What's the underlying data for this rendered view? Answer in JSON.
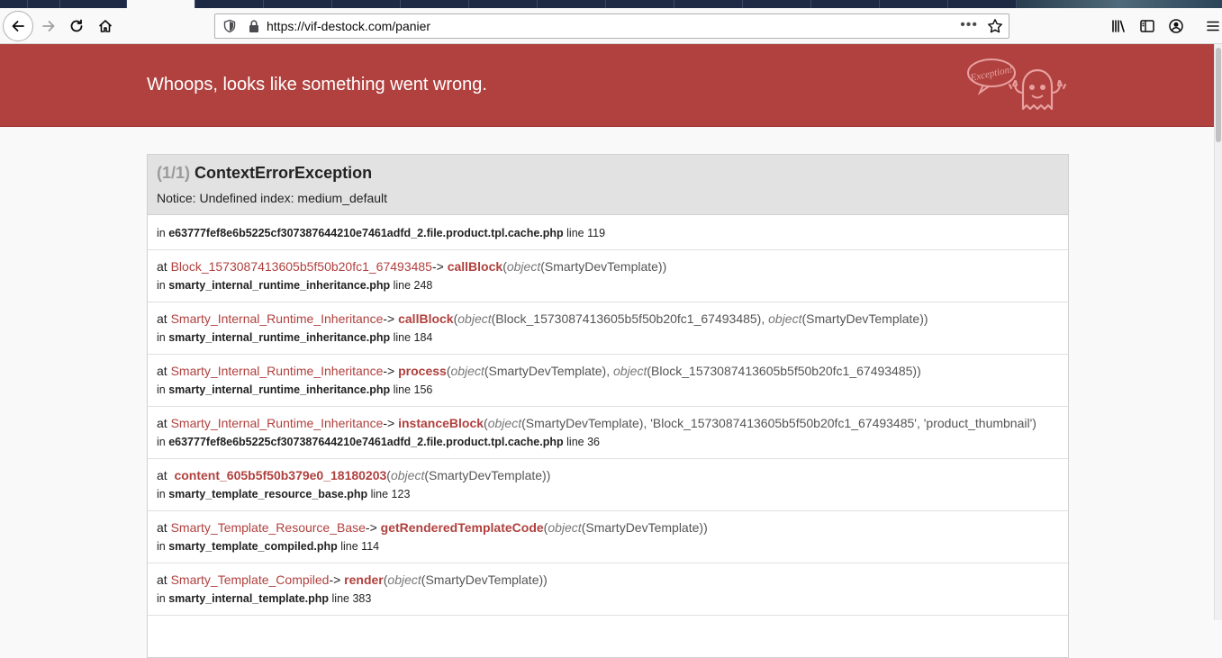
{
  "browser": {
    "url": "https://vif-destock.com/panier",
    "urlbar_menu_label": "•••"
  },
  "exception": {
    "header_title": "Whoops, looks like something went wrong.",
    "mascot_bubble_text": "Exception!",
    "count_label": "(1/1)",
    "class_name": "ContextErrorException",
    "message": "Notice: Undefined index: medium_default",
    "trace": [
      {
        "prefix": "in",
        "file": "e63777fef8e6b5225cf307387644210e7461adfd_2.file.product.tpl.cache.php",
        "line": "line 119"
      },
      {
        "prefix": "at",
        "class": "Block_1573087413605b5f50b20fc1_67493485",
        "arrow": "->",
        "method": "callBlock",
        "open": "(",
        "args": "object(SmartyDevTemplate)",
        "close": ")",
        "in_file": "smarty_internal_runtime_inheritance.php",
        "in_line": "line 248"
      },
      {
        "prefix": "at",
        "class": "Smarty_Internal_Runtime_Inheritance",
        "arrow": "->",
        "method": "callBlock",
        "open": "(",
        "args": "object(Block_1573087413605b5f50b20fc1_67493485), object(SmartyDevTemplate)",
        "close": ")",
        "in_file": "smarty_internal_runtime_inheritance.php",
        "in_line": "line 184"
      },
      {
        "prefix": "at",
        "class": "Smarty_Internal_Runtime_Inheritance",
        "arrow": "->",
        "method": "process",
        "open": "(",
        "args": "object(SmartyDevTemplate), object(Block_1573087413605b5f50b20fc1_67493485)",
        "close": ")",
        "in_file": "smarty_internal_runtime_inheritance.php",
        "in_line": "line 156"
      },
      {
        "prefix": "at",
        "class": "Smarty_Internal_Runtime_Inheritance",
        "arrow": "->",
        "method": "instanceBlock",
        "open": "(",
        "args": "object(SmartyDevTemplate), 'Block_1573087413605b5f50b20fc1_67493485', 'product_thumbnail'",
        "close": ")",
        "in_file": "e63777fef8e6b5225cf307387644210e7461adfd_2.file.product.tpl.cache.php",
        "in_line": "line 36"
      },
      {
        "prefix": "at",
        "class": "",
        "arrow": "",
        "method": "content_605b5f50b379e0_18180203",
        "open": "(",
        "args": "object(SmartyDevTemplate)",
        "close": ")",
        "in_file": "smarty_template_resource_base.php",
        "in_line": "line 123"
      },
      {
        "prefix": "at",
        "class": "Smarty_Template_Resource_Base",
        "arrow": "->",
        "method": "getRenderedTemplateCode",
        "open": "(",
        "args": "object(SmartyDevTemplate)",
        "close": ")",
        "in_file": "smarty_template_compiled.php",
        "in_line": "line 114"
      },
      {
        "prefix": "at",
        "class": "Smarty_Template_Compiled",
        "arrow": "->",
        "method": "render",
        "open": "(",
        "args": "object(SmartyDevTemplate)",
        "close": ")",
        "in_file": "smarty_internal_template.php",
        "in_line": "line 383"
      }
    ]
  },
  "colors": {
    "header_bg": "#b0413e",
    "accent": "#b0413e",
    "panel_head_bg": "#e2e2e2"
  },
  "icons": [
    "back-arrow-icon",
    "forward-arrow-icon",
    "reload-icon",
    "home-icon",
    "shield-icon",
    "lock-icon",
    "bookmark-star-icon",
    "library-icon",
    "sidebar-icon",
    "account-icon",
    "hamburger-menu-icon"
  ]
}
